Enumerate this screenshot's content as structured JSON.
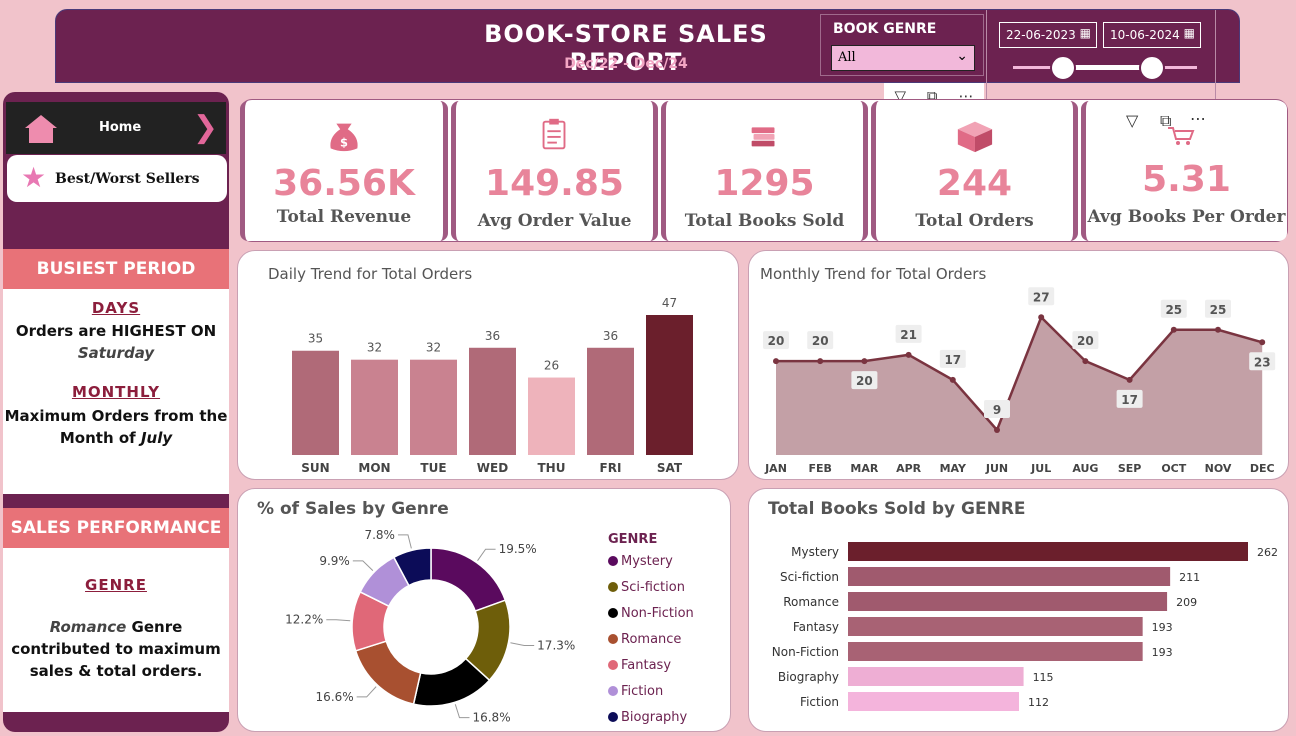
{
  "header": {
    "title": "BOOK-STORE SALES REPORT",
    "subtitle": "Dec/22 - Dec/24",
    "genre_filter": {
      "label": "BOOK GENRE",
      "value": "All"
    },
    "date_range": {
      "start": "22-06-2023",
      "end": "10-06-2024"
    }
  },
  "sidebar": {
    "home_label": "Home",
    "best_label": "Best/Worst Sellers",
    "busiest": {
      "heading": "BUSIEST PERIOD",
      "days_link": "DAYS",
      "days_text": "Orders are HIGHEST ON",
      "days_value": "Saturday",
      "monthly_link": "MONTHLY",
      "monthly_text_1": "Maximum Orders from the",
      "monthly_text_2": "Month of",
      "monthly_value": "July"
    },
    "sales": {
      "heading": "SALES PERFORMANCE",
      "genre_link": "GENRE",
      "genre_value": "Romance",
      "text_1": "Genre",
      "text_2": "contributed to maximum",
      "text_3": "sales & total orders."
    }
  },
  "kpis": [
    {
      "value": "36.56K",
      "label": "Total Revenue",
      "icon": "money-bag-icon"
    },
    {
      "value": "149.85",
      "label": "Avg Order Value",
      "icon": "clipboard-icon"
    },
    {
      "value": "1295",
      "label": "Total Books Sold",
      "icon": "books-icon"
    },
    {
      "value": "244",
      "label": "Total Orders",
      "icon": "box-icon"
    },
    {
      "value": "5.31",
      "label": "Avg Books Per Order",
      "icon": "cart-icon"
    }
  ],
  "chart_data": [
    {
      "type": "bar",
      "title": "Daily Trend for Total Orders",
      "categories": [
        "SUN",
        "MON",
        "TUE",
        "WED",
        "THU",
        "FRI",
        "SAT"
      ],
      "values": [
        35,
        32,
        32,
        36,
        26,
        36,
        47
      ],
      "colors": [
        "#b06a78",
        "#c98290",
        "#c98290",
        "#b06a78",
        "#eeb3bb",
        "#b06a78",
        "#6b1f2c"
      ]
    },
    {
      "type": "area",
      "title": "Monthly Trend for Total Orders",
      "categories": [
        "JAN",
        "FEB",
        "MAR",
        "APR",
        "MAY",
        "JUN",
        "JUL",
        "AUG",
        "SEP",
        "OCT",
        "NOV",
        "DEC"
      ],
      "values": [
        20,
        20,
        20,
        21,
        17,
        9,
        27,
        20,
        17,
        25,
        25,
        23
      ],
      "fill": "#c3a0a6",
      "line": "#7a3440"
    },
    {
      "type": "pie",
      "title": "% of Sales by Genre",
      "legend_title": "GENRE",
      "slices": [
        {
          "name": "Mystery",
          "value": 19.5,
          "label": "19.5%",
          "color": "#5a0a5e"
        },
        {
          "name": "Sci-fiction",
          "value": 17.3,
          "label": "17.3%",
          "color": "#6e5e0a"
        },
        {
          "name": "Non-Fiction",
          "value": 16.8,
          "label": "16.8%",
          "color": "#000000"
        },
        {
          "name": "Romance",
          "value": 16.6,
          "label": "16.6%",
          "color": "#a85030"
        },
        {
          "name": "Fantasy",
          "value": 12.2,
          "label": "12.2%",
          "color": "#e06878"
        },
        {
          "name": "Fiction",
          "value": 9.9,
          "label": "9.9%",
          "color": "#b090d8"
        },
        {
          "name": "Biography",
          "value": 7.8,
          "label": "7.8%",
          "color": "#0c0c58"
        }
      ]
    },
    {
      "type": "bar",
      "orientation": "horizontal",
      "title": "Total Books Sold by GENRE",
      "categories": [
        "Mystery",
        "Sci-fiction",
        "Romance",
        "Fantasy",
        "Non-Fiction",
        "Biography",
        "Fiction"
      ],
      "values": [
        262,
        211,
        209,
        193,
        193,
        115,
        112
      ],
      "colors": [
        "#6b1f2c",
        "#a05a6e",
        "#a05a6e",
        "#a86274",
        "#a86274",
        "#eeaed4",
        "#f4b4dc"
      ]
    }
  ]
}
